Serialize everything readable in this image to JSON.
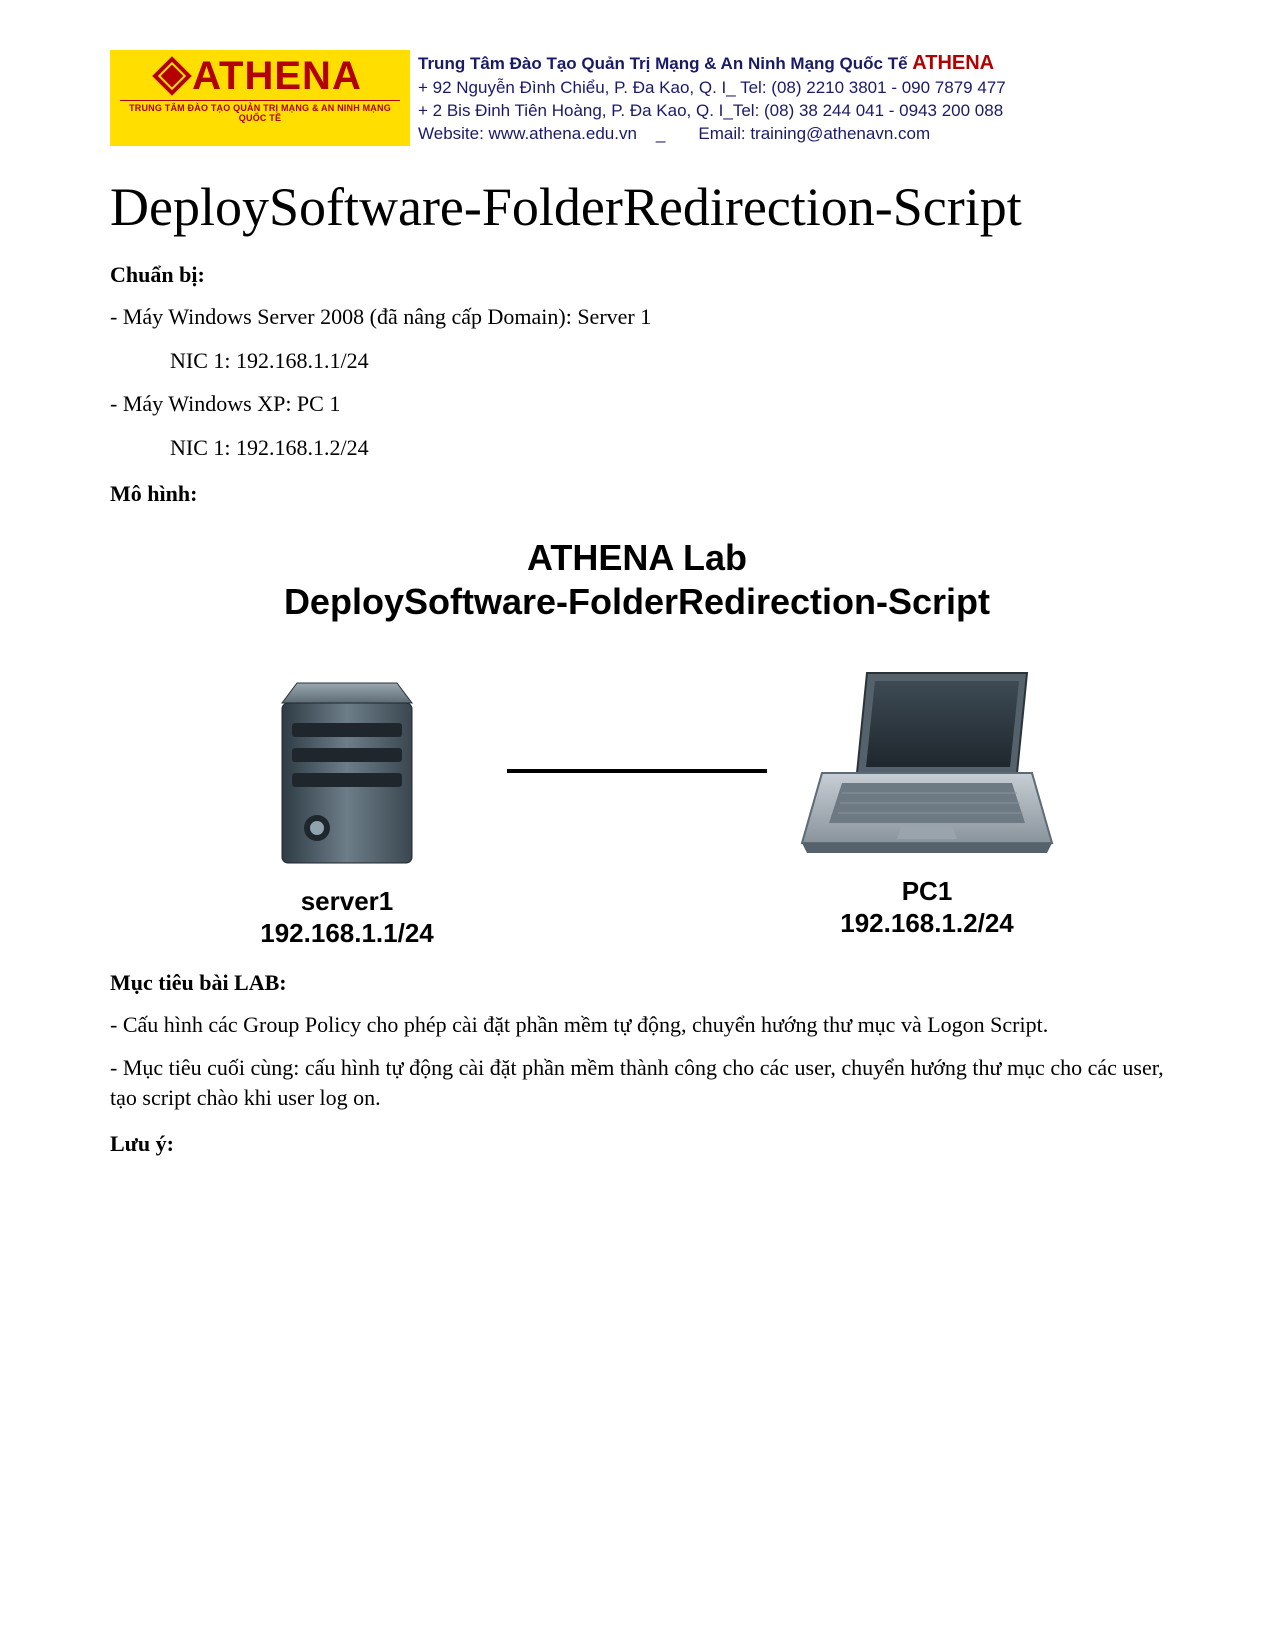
{
  "header": {
    "logo_name": "ATHENA",
    "logo_sub": "TRUNG TÂM ĐÀO TẠO QUẢN TRỊ MẠNG & AN NINH MẠNG QUỐC TẾ",
    "line1_prefix": "Trung Tâm Đào Tạo Quản Trị Mạng & An Ninh Mạng Quốc Tế ",
    "line1_brand": "ATHENA",
    "line2": "+  92 Nguyễn Đình Chiểu, P. Đa Kao, Q. I_ Tel: (08) 2210 3801 -  090 7879 477",
    "line3": "+  2 Bis Đinh Tiên Hoàng, P. Đa Kao, Q. I_Tel: (08) 38 244 041 - 0943 200 088",
    "line4_left": "Website:  www.athena.edu.vn",
    "line4_right": "Email: training@athenavn.com"
  },
  "title": "DeploySoftware-FolderRedirection-Script",
  "sections": {
    "prep_label": "Chuẩn bị:",
    "prep_line1": "- Máy Windows Server 2008 (đã nâng cấp Domain): Server 1",
    "prep_nic1": "NIC 1: 192.168.1.1/24",
    "prep_line2": "- Máy Windows XP: PC 1",
    "prep_nic2": "NIC 1: 192.168.1.2/24",
    "model_label": "Mô hình:",
    "goal_label": "Mục tiêu bài LAB:",
    "goal_p1": "- Cấu hình các Group Policy cho phép cài đặt phần mềm tự động, chuyển hướng thư mục và Logon Script.",
    "goal_p2": "- Mục tiêu cuối cùng: cấu hình tự động cài đặt phần mềm thành công cho các user, chuyển hướng thư mục cho các user, tạo script chào khi user log on.",
    "note_label": "Lưu ý:"
  },
  "diagram": {
    "title": "ATHENA Lab",
    "subtitle": "DeploySoftware-FolderRedirection-Script",
    "node1_name": "server1",
    "node1_ip": "192.168.1.1/24",
    "node2_name": "PC1",
    "node2_ip": "192.168.1.2/24"
  }
}
